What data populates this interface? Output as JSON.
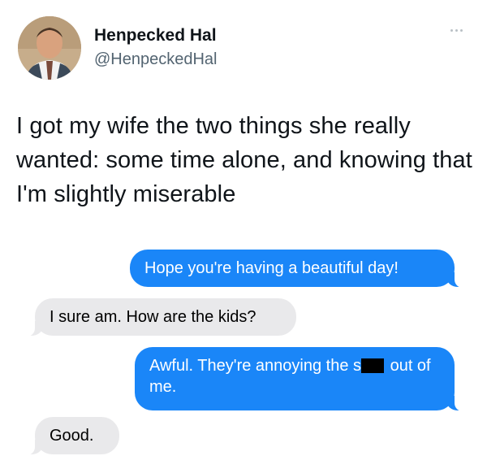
{
  "user": {
    "name": "Henpecked Hal",
    "handle": "@HenpeckedHal"
  },
  "tweet": {
    "text": "I got my wife the two things she really wanted: some time alone, and knowing that I'm slightly miserable"
  },
  "messages": [
    {
      "from": "sent",
      "text": "Hope you're having a beautiful day!"
    },
    {
      "from": "received",
      "text": "I sure am. How are the kids?"
    },
    {
      "from": "sent",
      "text_before": "Awful. They're annoying the s",
      "text_after": " out of me.",
      "redacted": true
    },
    {
      "from": "received",
      "text": "Good."
    }
  ],
  "icons": {
    "more": "more-horizontal-icon"
  },
  "colors": {
    "sent_bubble": "#1a86f8",
    "received_bubble": "#e9e9eb",
    "handle": "#536471"
  }
}
